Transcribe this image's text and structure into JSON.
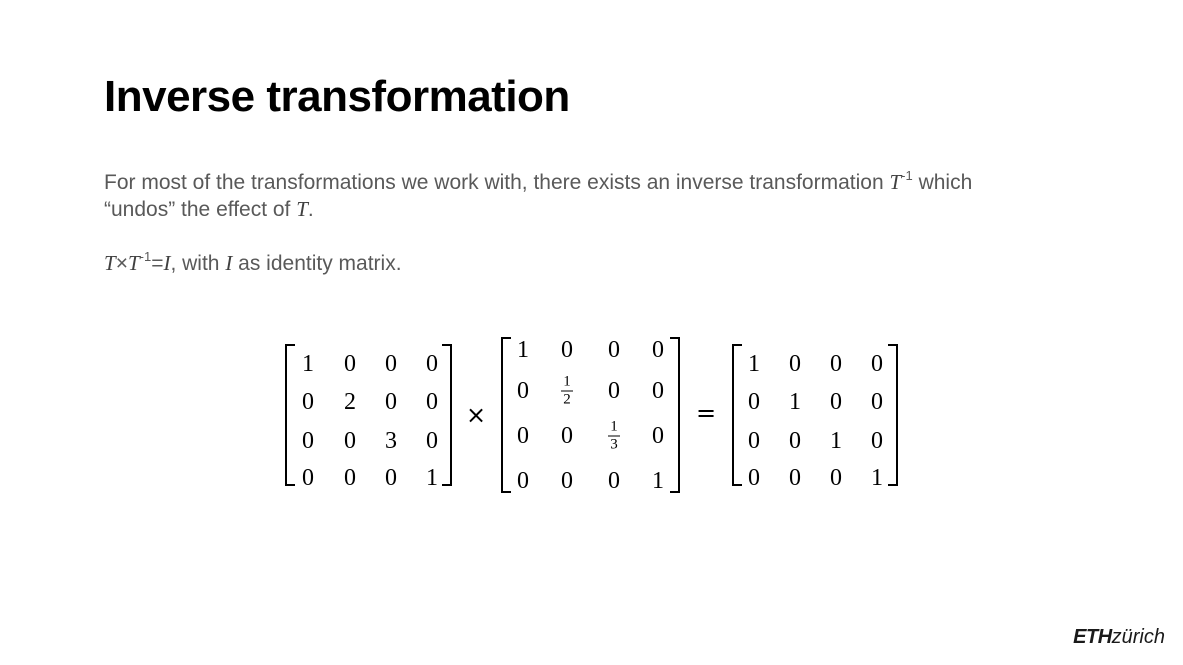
{
  "slide": {
    "title": "Inverse transformation",
    "para1": {
      "a": "For most of the transformations we work with, there exists an inverse transformation ",
      "T": "T",
      "sup": "-1",
      "b": " which ",
      "c": "“undos” the effect of ",
      "T2": "T",
      "end": "."
    },
    "para2": {
      "T": "T",
      "times": "×",
      "T2": "T",
      "sup": "-1",
      "eq": "=",
      "I": "I",
      "mid": ", with ",
      "I2": "I",
      "end": " as identity matrix."
    }
  },
  "equation": {
    "matrixA": [
      [
        "1",
        "0",
        "0",
        "0"
      ],
      [
        "0",
        "2",
        "0",
        "0"
      ],
      [
        "0",
        "0",
        "3",
        "0"
      ],
      [
        "0",
        "0",
        "0",
        "1"
      ]
    ],
    "matrixB": [
      [
        "1",
        "0",
        "0",
        "0"
      ],
      [
        "0",
        "1/2",
        "0",
        "0"
      ],
      [
        "0",
        "0",
        "1/3",
        "0"
      ],
      [
        "0",
        "0",
        "0",
        "1"
      ]
    ],
    "matrixC": [
      [
        "1",
        "0",
        "0",
        "0"
      ],
      [
        "0",
        "1",
        "0",
        "0"
      ],
      [
        "0",
        "0",
        "1",
        "0"
      ],
      [
        "0",
        "0",
        "0",
        "1"
      ]
    ],
    "op_times": "×",
    "op_equals": "="
  },
  "logo": {
    "eth": "ETH",
    "zurich": "zürich"
  }
}
